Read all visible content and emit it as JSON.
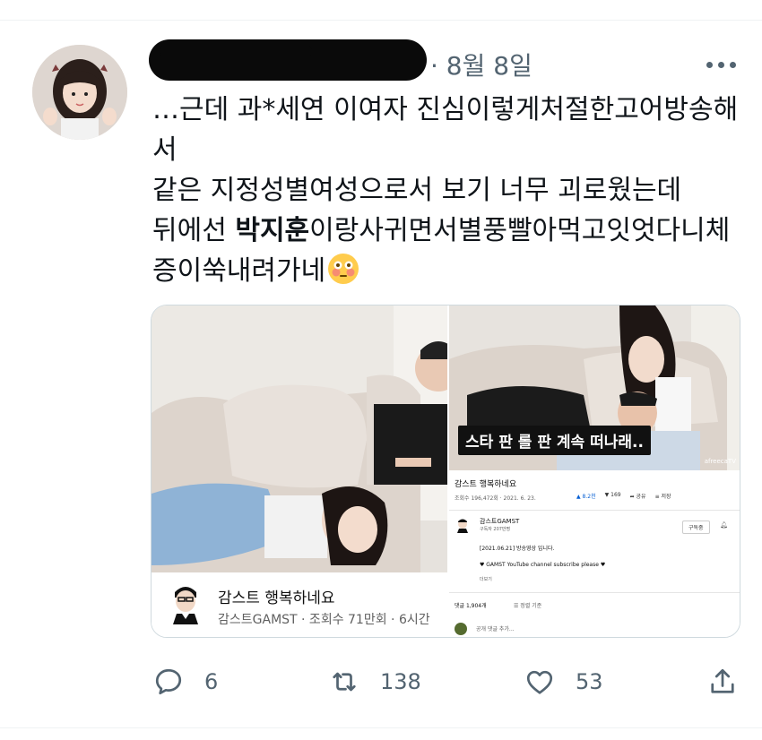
{
  "tweet": {
    "date": "· 8월 8일",
    "text_lines": [
      "…근데 과*세연 이여자 진심이렇게처절한고어방송해",
      "서",
      "같은 지정성별여성으로서 보기 너무 괴로웠는데"
    ],
    "line4_before": "뒤에선 ",
    "line4_bold": "박지훈",
    "line4_after": "이랑사귀면서별풍빨아먹고잇엇다니체",
    "line5": "증이쑥내려가네",
    "emoji": "flushed-face"
  },
  "media": {
    "left": {
      "video_title": "감스트 행복하네요",
      "video_meta": "감스트GAMST · 조회수 71만회 · 6시간"
    },
    "right": {
      "caption": "스타 판 롤 판 계속 떠나래..",
      "watermark": "afreecaTV",
      "video_title": "감스트 행복하네요",
      "video_meta": "조회수 196,472회 · 2021. 6. 23.",
      "likes": "8.2천",
      "dislikes": "169",
      "share": "공유",
      "save": "저장",
      "channel_name": "감스트GAMST",
      "subscribers": "구독자 207만명",
      "subscribe_button": "구독중",
      "desc_line1": "[2021.06.21] 방송영상 입니다.",
      "desc_line2": "♥ GAMST YouTube channel subscribe please ♥",
      "more": "더보기",
      "comments": "댓글 1,904개",
      "sort": "정렬 기준",
      "add_comment": "공개 댓글 추가..."
    }
  },
  "actions": {
    "replies": "6",
    "retweets": "138",
    "likes": "53"
  },
  "colors": {
    "text": "#0f1419",
    "secondary": "#536471",
    "border": "#cfd9de",
    "youtube_blue": "#065fd4"
  }
}
